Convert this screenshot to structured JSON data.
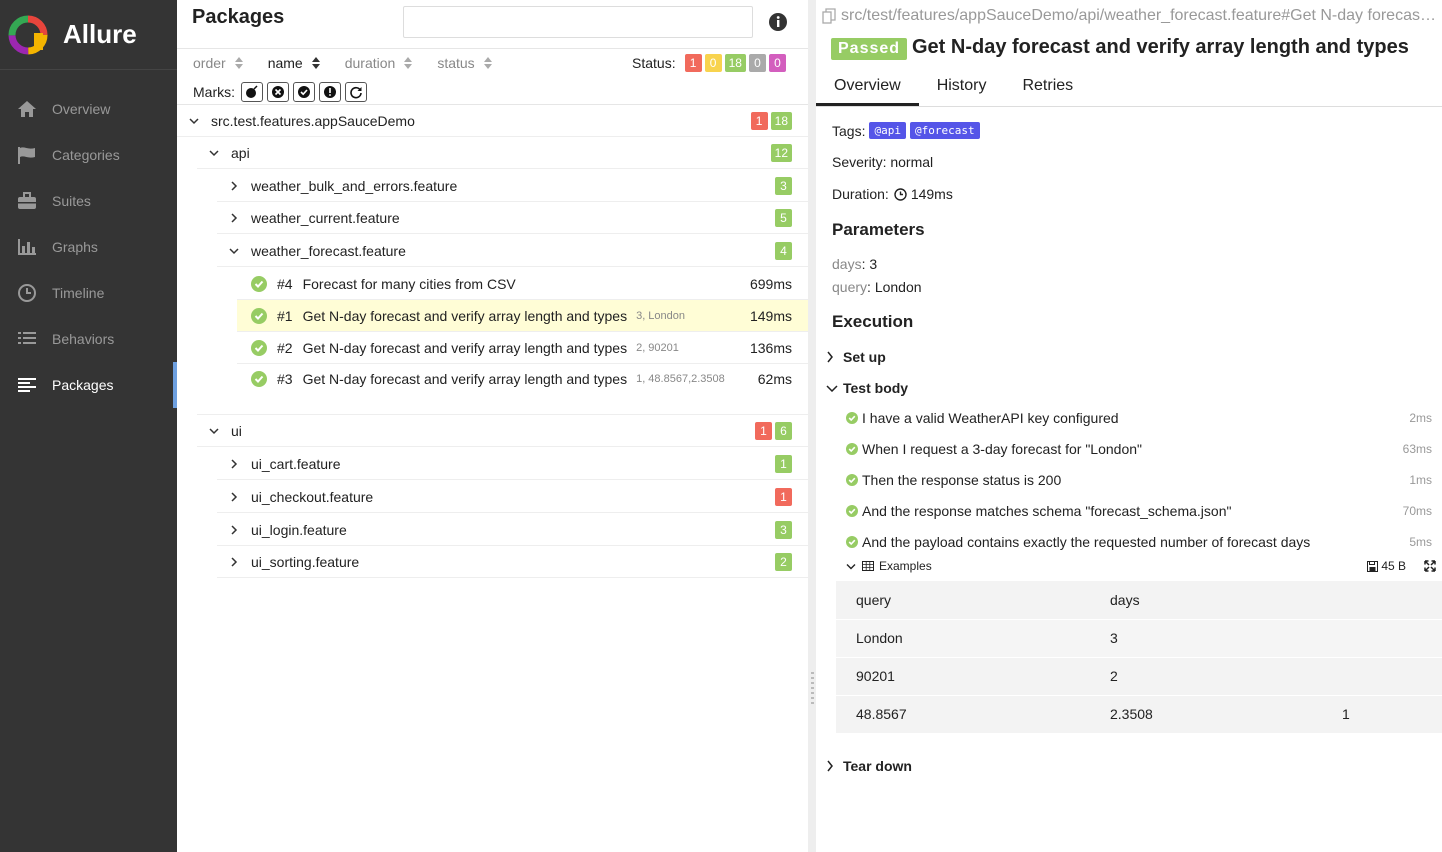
{
  "brand": {
    "name": "Allure"
  },
  "nav": [
    {
      "label": "Overview",
      "icon": "home-icon"
    },
    {
      "label": "Categories",
      "icon": "flag-icon"
    },
    {
      "label": "Suites",
      "icon": "briefcase-icon"
    },
    {
      "label": "Graphs",
      "icon": "bar-chart-icon"
    },
    {
      "label": "Timeline",
      "icon": "clock-icon"
    },
    {
      "label": "Behaviors",
      "icon": "list-icon"
    },
    {
      "label": "Packages",
      "icon": "align-left-icon",
      "active": true
    }
  ],
  "tree_pane": {
    "title": "Packages",
    "search": {
      "value": "",
      "placeholder": ""
    },
    "sorters": [
      "order",
      "name",
      "duration",
      "status"
    ],
    "active_sorter": "name",
    "status_label": "Status:",
    "status_counts": {
      "failed": "1",
      "broken": "0",
      "passed": "18",
      "skipped": "0",
      "unknown": "0"
    },
    "marks_label": "Marks:",
    "marks": [
      "flaky-icon",
      "new-failed-icon",
      "new-passed-icon",
      "new-broken-icon",
      "retries-icon"
    ]
  },
  "tree": {
    "root": {
      "name": "src.test.features.appSauceDemo",
      "failed": "1",
      "passed": "18"
    },
    "api": {
      "name": "api",
      "passed": "12"
    },
    "api_features": [
      {
        "name": "weather_bulk_and_errors.feature",
        "passed": "3"
      },
      {
        "name": "weather_current.feature",
        "passed": "5"
      },
      {
        "name": "weather_forecast.feature",
        "passed": "4"
      }
    ],
    "forecast_tests": [
      {
        "num": "#4",
        "title": "Forecast for many cities from CSV",
        "params": "",
        "duration": "699ms"
      },
      {
        "num": "#1",
        "title": "Get N-day forecast and verify array length and types",
        "params": "3, London",
        "duration": "149ms"
      },
      {
        "num": "#2",
        "title": "Get N-day forecast and verify array length and types",
        "params": "2, 90201",
        "duration": "136ms"
      },
      {
        "num": "#3",
        "title": "Get N-day forecast and verify array length and types",
        "params": "1, 48.8567,2.3508",
        "duration": "62ms"
      }
    ],
    "ui": {
      "name": "ui",
      "failed": "1",
      "passed": "6"
    },
    "ui_features": [
      {
        "name": "ui_cart.feature",
        "count": "1",
        "status": "passed"
      },
      {
        "name": "ui_checkout.feature",
        "count": "1",
        "status": "failed"
      },
      {
        "name": "ui_login.feature",
        "count": "3",
        "status": "passed"
      },
      {
        "name": "ui_sorting.feature",
        "count": "2",
        "status": "passed"
      }
    ]
  },
  "detail": {
    "path": "src/test/features/appSauceDemo/api/weather_forecast.feature#Get N-day forecast ...",
    "status": "Passed",
    "title": "Get N-day forecast and verify array length and types",
    "tabs": [
      "Overview",
      "History",
      "Retries"
    ],
    "tags_label": "Tags:",
    "tags": [
      "@api",
      "@forecast"
    ],
    "severity": "Severity: normal",
    "duration_label": "Duration:",
    "duration": "149ms",
    "parameters_heading": "Parameters",
    "parameters": [
      {
        "key": "days",
        "value": "3"
      },
      {
        "key": "query",
        "value": "London"
      }
    ],
    "execution_heading": "Execution",
    "setup_label": "Set up",
    "body_label": "Test body",
    "teardown_label": "Tear down",
    "steps": [
      {
        "text": "I have a valid WeatherAPI key configured",
        "duration": "2ms"
      },
      {
        "text": "When I request a 3-day forecast for \"London\"",
        "duration": "63ms"
      },
      {
        "text": "Then the response status is 200",
        "duration": "1ms"
      },
      {
        "text": "And the response matches schema \"forecast_schema.json\"",
        "duration": "70ms"
      },
      {
        "text": "And the payload contains exactly the requested number of forecast days",
        "duration": "5ms"
      }
    ],
    "attachment": {
      "name": "Examples",
      "size": "45 B"
    },
    "examples": {
      "header": [
        "query",
        "days",
        ""
      ],
      "rows": [
        [
          "London",
          "3",
          ""
        ],
        [
          "90201",
          "2",
          ""
        ],
        [
          "48.8567",
          "2.3508",
          "1"
        ]
      ]
    }
  },
  "colors": {
    "passed": "#97cc64",
    "failed": "#f16a5c",
    "broken": "#f8d34e",
    "skipped": "#aaaaaa",
    "unknown": "#d35ebe",
    "tag": "#5555e8",
    "sidebar": "#343434"
  }
}
